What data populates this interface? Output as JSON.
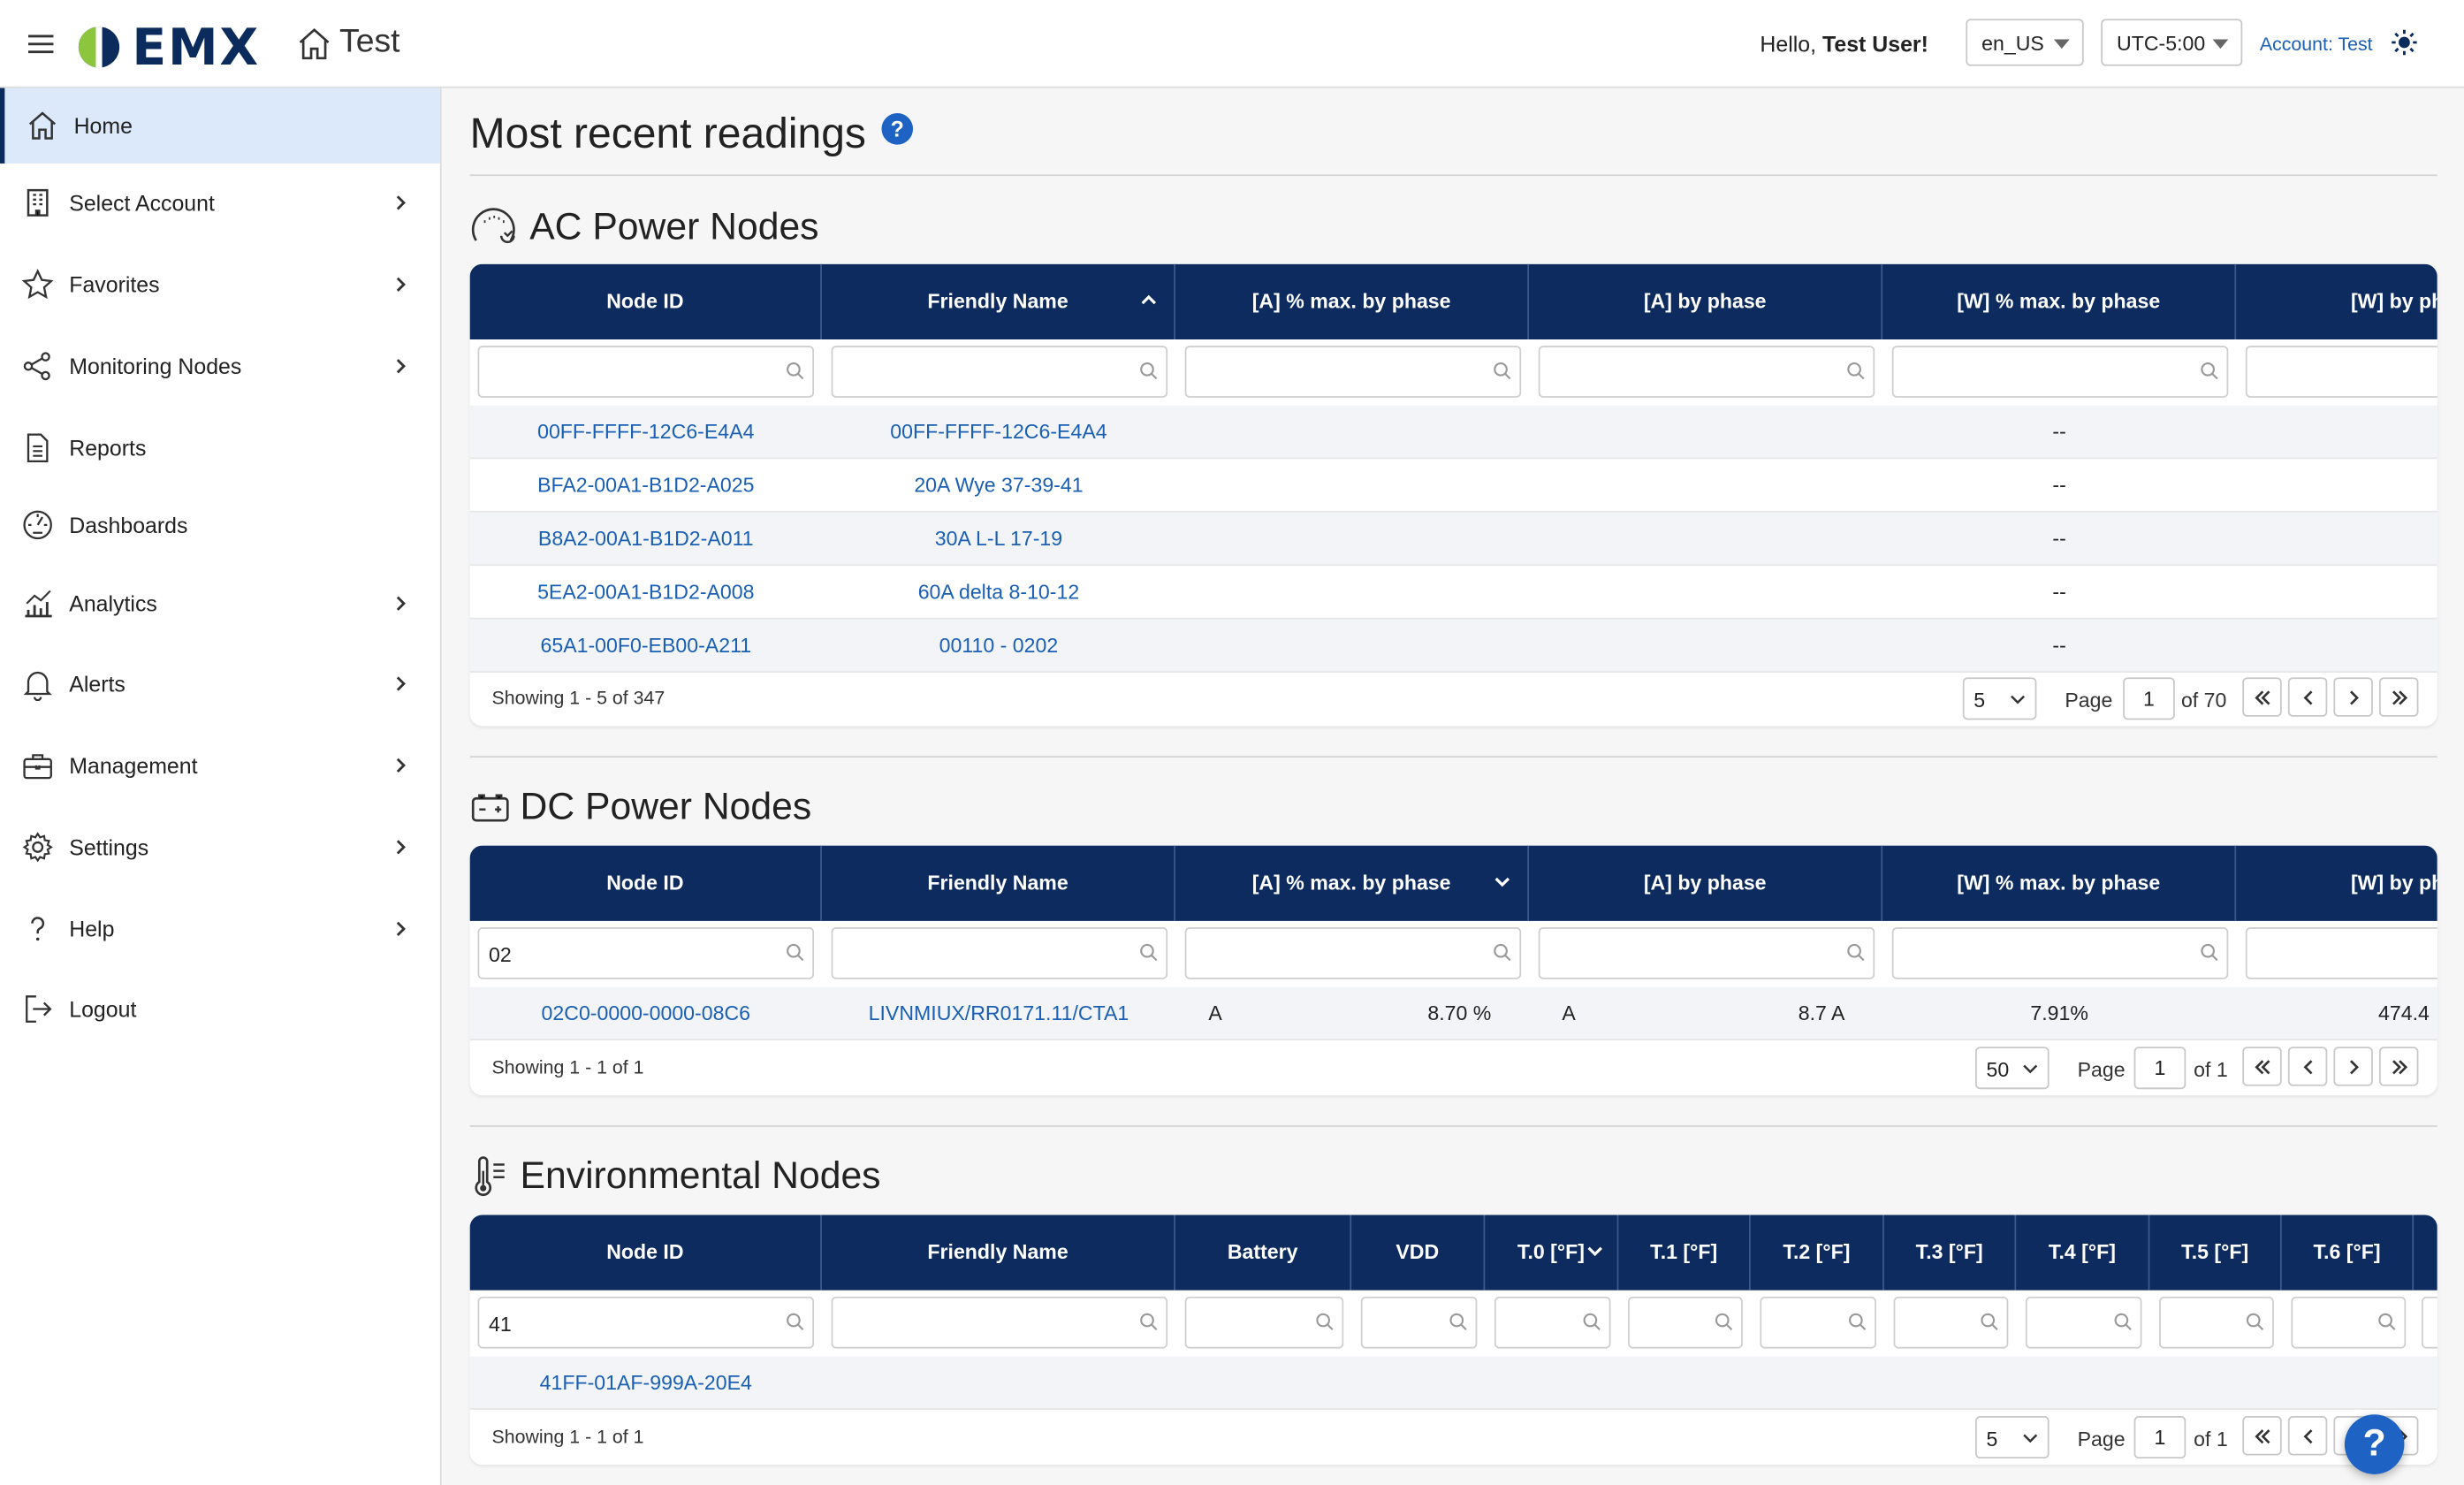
{
  "header": {
    "brand": "EMX",
    "app_title": "Test",
    "hello_prefix": "Hello, ",
    "user_name": "Test User!",
    "locale": "en_US",
    "timezone": "UTC-5:00",
    "account_link": "Account: Test"
  },
  "sidebar": {
    "items": [
      {
        "label": "Home",
        "icon": "home-icon",
        "active": true
      },
      {
        "label": "Select Account",
        "icon": "building-icon",
        "chevron": true
      },
      {
        "label": "Favorites",
        "icon": "star-icon",
        "chevron": true
      },
      {
        "label": "Monitoring Nodes",
        "icon": "share-nodes-icon",
        "chevron": true
      },
      {
        "label": "Reports",
        "icon": "document-icon"
      },
      {
        "label": "Dashboards",
        "icon": "gauge-icon"
      },
      {
        "label": "Analytics",
        "icon": "bar-chart-icon",
        "chevron": true
      },
      {
        "label": "Alerts",
        "icon": "bell-icon",
        "chevron": true
      },
      {
        "label": "Management",
        "icon": "briefcase-icon",
        "chevron": true
      },
      {
        "label": "Settings",
        "icon": "gear-icon",
        "chevron": true
      },
      {
        "label": "Help",
        "icon": "question-icon",
        "chevron": true
      },
      {
        "label": "Logout",
        "icon": "logout-icon"
      }
    ]
  },
  "main": {
    "title": "Most recent readings",
    "help_badge": "?",
    "ac": {
      "title": "AC Power Nodes",
      "columns": [
        "Node ID",
        "Friendly Name",
        "[A] % max. by phase",
        "[A] by phase",
        "[W] % max. by phase",
        "[W] by ph"
      ],
      "filters": [
        "",
        "",
        "",
        "",
        "",
        ""
      ],
      "rows": [
        {
          "node_id": "00FF-FFFF-12C6-E4A4",
          "name": "00FF-FFFF-12C6-E4A4",
          "w_pct": "--"
        },
        {
          "node_id": "BFA2-00A1-B1D2-A025",
          "name": "20A Wye 37-39-41",
          "w_pct": "--"
        },
        {
          "node_id": "B8A2-00A1-B1D2-A011",
          "name": "30A L-L 17-19",
          "w_pct": "--"
        },
        {
          "node_id": "5EA2-00A1-B1D2-A008",
          "name": "60A delta 8-10-12",
          "w_pct": "--"
        },
        {
          "node_id": "65A1-00F0-EB00-A211",
          "name": "00110 - 0202",
          "w_pct": "--"
        }
      ],
      "showing": "Showing 1 - 5 of 347",
      "page_size": "5",
      "page_label": "Page",
      "page": "1",
      "of_pages": "of 70"
    },
    "dc": {
      "title": "DC Power Nodes",
      "columns": [
        "Node ID",
        "Friendly Name",
        "[A] % max. by phase",
        "[A] by phase",
        "[W] % max. by phase",
        "[W] by ph"
      ],
      "filters": [
        "02",
        "",
        "",
        "",
        "",
        ""
      ],
      "rows": [
        {
          "node_id": "02C0-0000-0000-08C6",
          "name": "LIVNMIUX/RR0171.11/CTA1",
          "a_pct_phase": "A",
          "a_pct": "8.70 %",
          "a_phase": "A",
          "a_val": "8.7 A",
          "w_pct": "7.91%",
          "w_val": "474.4"
        }
      ],
      "showing": "Showing 1 - 1 of 1",
      "page_size": "50",
      "page_label": "Page",
      "page": "1",
      "of_pages": "of 1"
    },
    "env": {
      "title": "Environmental Nodes",
      "columns": [
        "Node ID",
        "Friendly Name",
        "Battery",
        "VDD",
        "T.0 [°F]",
        "T.1 [°F]",
        "T.2 [°F]",
        "T.3 [°F]",
        "T.4 [°F]",
        "T.5 [°F]",
        "T.6 [°F]"
      ],
      "filters": [
        "41",
        "",
        "",
        "",
        "",
        "",
        "",
        "",
        "",
        "",
        ""
      ],
      "rows": [
        {
          "node_id": "41FF-01AF-999A-20E4"
        }
      ],
      "showing": "Showing 1 - 1 of 1",
      "page_size": "5",
      "page_label": "Page",
      "page": "1",
      "of_pages": "of 1"
    },
    "fab_label": "?"
  },
  "colors": {
    "table_header": "#0d2b5e",
    "link": "#1a5fb4",
    "active_nav": "#dbe9fb",
    "accent": "#1e63c4"
  }
}
